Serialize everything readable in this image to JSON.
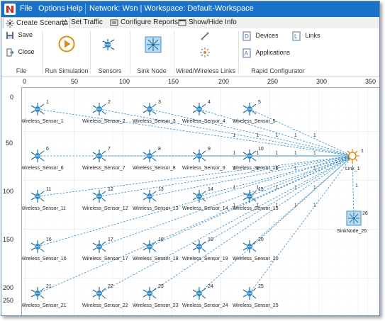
{
  "titlebar": {
    "menu": [
      "File",
      "Options",
      "Help"
    ],
    "network": "Network: Wsn | Workspace: Default-Workspace"
  },
  "tabs": [
    "Create Scenario",
    "Set Traffic",
    "Configure Reports",
    "Show/Hide Info"
  ],
  "ribbon": {
    "save": "Save",
    "close": "Close",
    "groups": [
      "File",
      "Run Simulation",
      "Sensors",
      "Sink Node",
      "Wired/Wireless Links",
      "Rapid Configurator"
    ],
    "rapid": [
      "Devices",
      "Links",
      "Applications"
    ]
  },
  "ruler": {
    "x": [
      "0",
      "50",
      "100",
      "150",
      "200",
      "250",
      "300",
      "350"
    ],
    "y": [
      "0",
      "50",
      "100",
      "150",
      "200",
      "250"
    ]
  },
  "sensors": [
    {
      "id": "1",
      "name": "Wireless_Sensor_1"
    },
    {
      "id": "2",
      "name": "Wireless_Sensor_2"
    },
    {
      "id": "3",
      "name": "Wireless_Sensor_3"
    },
    {
      "id": "4",
      "name": "Wireless_Sensor_4"
    },
    {
      "id": "5",
      "name": "Wireless_Sensor_5"
    },
    {
      "id": "6",
      "name": "Wireless_Sensor_6"
    },
    {
      "id": "7",
      "name": "Wireless_Sensor_7"
    },
    {
      "id": "8",
      "name": "Wireless_Sensor_8"
    },
    {
      "id": "9",
      "name": "Wireless_Sensor_9"
    },
    {
      "id": "10",
      "name": "Wireless_Sensor_10"
    },
    {
      "id": "11",
      "name": "Wireless_Sensor_11"
    },
    {
      "id": "12",
      "name": "Wireless_Sensor_12"
    },
    {
      "id": "13",
      "name": "Wireless_Sensor_13"
    },
    {
      "id": "14",
      "name": "Wireless_Sensor_14"
    },
    {
      "id": "15",
      "name": "Wireless_Sensor_15"
    },
    {
      "id": "16",
      "name": "Wireless_Sensor_16"
    },
    {
      "id": "17",
      "name": "Wireless_Sensor_17"
    },
    {
      "id": "18",
      "name": "Wireless_Sensor_18"
    },
    {
      "id": "19",
      "name": "Wireless_Sensor_19"
    },
    {
      "id": "20",
      "name": "Wireless_Sensor_20"
    },
    {
      "id": "21",
      "name": "Wireless_Sensor_21"
    },
    {
      "id": "22",
      "name": "Wireless_Sensor_22"
    },
    {
      "id": "23",
      "name": "Wireless_Sensor_23"
    },
    {
      "id": "24",
      "name": "Wireless_Sensor_24"
    },
    {
      "id": "25",
      "name": "Wireless_Sensor_25"
    }
  ],
  "link": {
    "id": "1",
    "name": "Link_1",
    "edge_label": "1"
  },
  "sink": {
    "id": "26",
    "name": "SinkNode_26"
  }
}
